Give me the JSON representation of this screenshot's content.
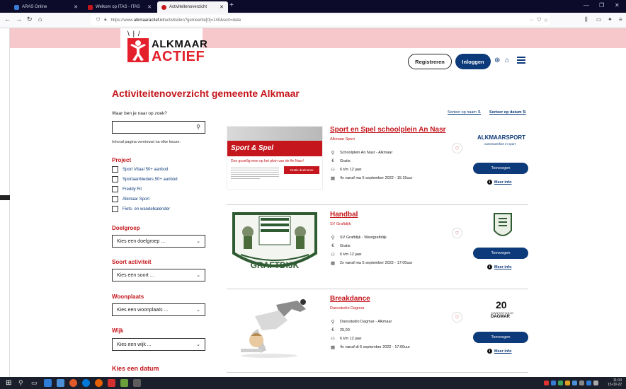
{
  "browser": {
    "tabs": [
      {
        "label": "ARAS Online",
        "active": false,
        "favicon_color": "#3a7bd5"
      },
      {
        "label": "Welkom op ITAS - ITAS",
        "active": false,
        "favicon_color": "#c4161c"
      },
      {
        "label": "Activiteitenoverzicht",
        "active": true,
        "favicon_color": "#c4161c"
      }
    ],
    "new_tab": "+",
    "url_prefix": "https://www.",
    "url_domain": "alkmaaractief.nl",
    "url_rest": "/activiteiten?gemeente[0]=140&sort=date"
  },
  "header": {
    "logo_line1": "ALKMAAR",
    "logo_line2": "ACTIEF",
    "register_label": "Registreren",
    "login_label": "Inloggen"
  },
  "main": {
    "title": "Activiteitenoverzicht gemeente Alkmaar",
    "search": {
      "label": "Waar ben je naar op zoek?",
      "value": "",
      "note": "Inhoud pagina vernieuwt na elke keuze."
    },
    "project": {
      "title": "Project",
      "items": [
        "Sport Vitaal 50+ aanbod",
        "Sportaanbieders 50+ aanbod",
        "Freddy Fit",
        "Alkmaar Sport",
        "Fiets- en wandelkalender"
      ]
    },
    "filters": [
      {
        "title": "Doelgroep",
        "placeholder": "Kies een doelgroep ..."
      },
      {
        "title": "Soort activiteit",
        "placeholder": "Kies een soort ..."
      },
      {
        "title": "Woonplaats",
        "placeholder": "Kies een woonplaats ..."
      },
      {
        "title": "Wijk",
        "placeholder": "Kies een wijk ..."
      }
    ],
    "date_title": "Kies een datum",
    "sort_name": "Sorteer op naam",
    "sort_date": "Sorteer op datum",
    "add_label": "Toevoegen",
    "more_info": "Meer info",
    "activities": [
      {
        "title": "Sport en Spel schoolplein An Nasr",
        "org": "Alkmaar Sport",
        "location": "Schoolplein An Nasr - Alkmaar",
        "price": "Gratis",
        "age": "6 t/m 12 jaar",
        "when": "4x vanaf ma 5 september 2022 - 15:15uur",
        "flyer_title": "Sport & Spel",
        "flyer_sub": "Doe gezellig mee op het plein van de An Nasr!",
        "flyer_button": "Gratis deelname",
        "org_logo_1": "ALKMAARSPORT",
        "org_logo_2": "samenwerken in sport"
      },
      {
        "title": "Handbal",
        "org": "SV Graftdijk",
        "location": "SV Graftdijk - Westgraftdijk",
        "price": "Gratis",
        "age": "6 t/m 12 jaar",
        "when": "2x vanaf ma 5 september 2022 - 17:00uur",
        "banner_text": "GRAFTDIJK"
      },
      {
        "title": "Breakdance",
        "org": "Dansstudio Dagmar",
        "location": "Dansstudio Dagmar - Alkmaar",
        "price": "25,00",
        "age": "6 t/m 12 jaar",
        "when": "4x vanaf di 6 september 2022 - 17:00uur",
        "org_logo_1": "20",
        "org_logo_2": "DANSSTUDIO",
        "org_logo_3": "DAGMAR"
      }
    ]
  },
  "taskbar": {
    "time": "11:04",
    "date": "15-09-22"
  },
  "colors": {
    "brand_red": "#c4161c",
    "brand_blue": "#0d3a7a",
    "pink_band": "#f6c8cc"
  }
}
